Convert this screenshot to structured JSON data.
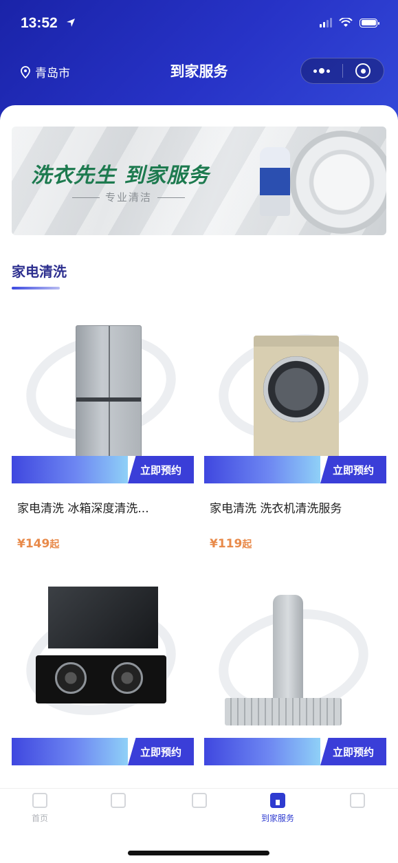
{
  "status": {
    "time": "13:52"
  },
  "nav": {
    "city": "青岛市",
    "title": "到家服务"
  },
  "banner": {
    "title": "洗衣先生 到家服务",
    "subtitle": "专业清洁"
  },
  "tabs": [
    {
      "label": "家电清洗",
      "active": true
    },
    {
      "label": "",
      "active": false
    },
    {
      "label": "",
      "active": false
    },
    {
      "label": "",
      "active": false
    }
  ],
  "products": [
    {
      "name": "家电清洗 冰箱深度清洗...",
      "price": "¥149",
      "unit": "起",
      "strip_text": "",
      "button": "立即预约",
      "icon": "fridge-image"
    },
    {
      "name": "家电清洗 洗衣机清洗服务",
      "price": "¥119",
      "unit": "起",
      "strip_text": "",
      "button": "立即预约",
      "icon": "washing-machine-image"
    },
    {
      "name": "",
      "price": "",
      "unit": "",
      "strip_text": "",
      "button": "立即预约",
      "icon": "range-hood-image"
    },
    {
      "name": "",
      "price": "",
      "unit": "",
      "strip_text": "",
      "button": "立即预约",
      "icon": "air-conditioner-image"
    }
  ],
  "tabbar": [
    {
      "label": "首页",
      "icon": "home-icon"
    },
    {
      "label": "",
      "icon": "category-icon"
    },
    {
      "label": "",
      "icon": "cart-icon"
    },
    {
      "label": "到家服务",
      "icon": "service-icon",
      "active": true
    },
    {
      "label": "",
      "icon": "profile-icon"
    }
  ],
  "colors": {
    "header": "#2733c7",
    "accent": "#3a3ed8",
    "price": "#e88a4a",
    "tab_active": "#2d2f8f"
  }
}
